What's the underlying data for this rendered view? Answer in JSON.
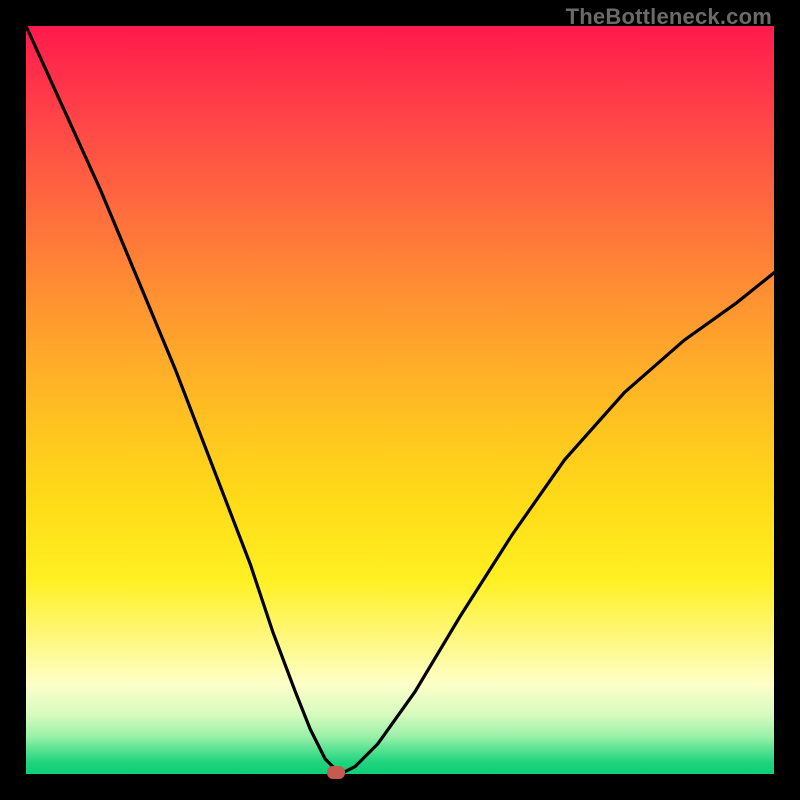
{
  "watermark": "TheBottleneck.com",
  "colors": {
    "frame": "#000000",
    "gradient_top": "#ff1a4d",
    "gradient_bottom": "#0fcf76",
    "curve": "#000000",
    "marker": "#c45a50"
  },
  "chart_data": {
    "type": "line",
    "title": "",
    "xlabel": "",
    "ylabel": "",
    "xlim": [
      0,
      100
    ],
    "ylim": [
      0,
      100
    ],
    "grid": false,
    "series": [
      {
        "name": "bottleneck-curve",
        "x": [
          0,
          5,
          10,
          15,
          20,
          25,
          30,
          33,
          36,
          38,
          40,
          41,
          42,
          44,
          47,
          52,
          58,
          65,
          72,
          80,
          88,
          95,
          100
        ],
        "values": [
          100,
          89,
          78,
          66,
          54,
          41,
          28,
          19,
          11,
          6,
          2,
          1,
          0,
          1,
          4,
          11,
          21,
          32,
          42,
          51,
          58,
          63,
          67
        ]
      }
    ],
    "annotations": [
      {
        "name": "optimum-marker",
        "x": 41.5,
        "y": 0
      }
    ]
  }
}
